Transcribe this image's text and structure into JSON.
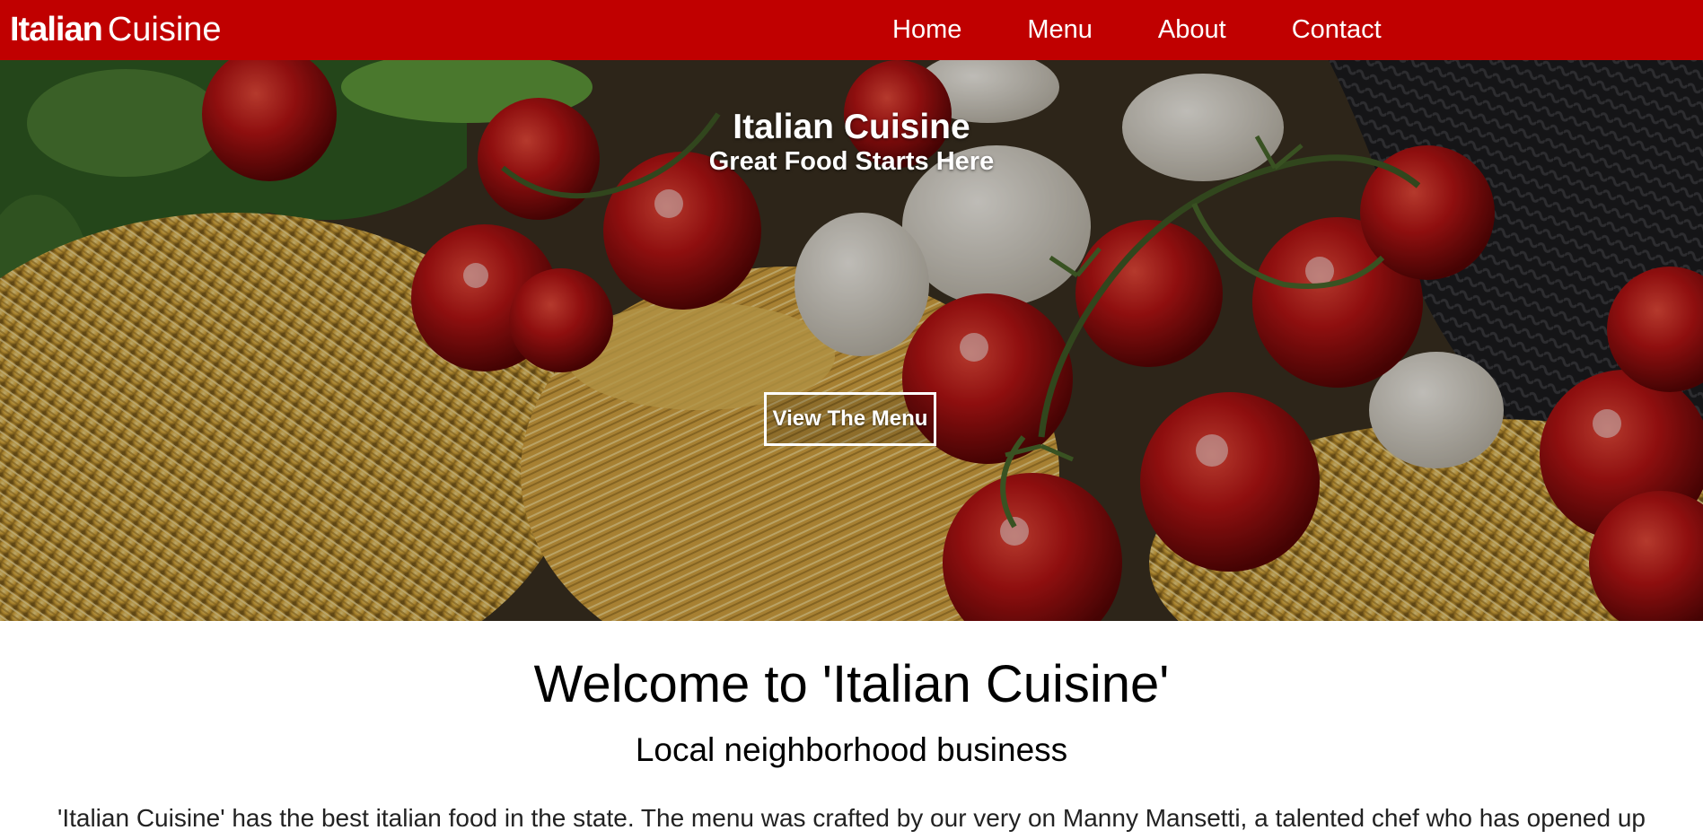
{
  "navbar": {
    "brand_bold": "Italian",
    "brand_light": "Cuisine",
    "links": [
      "Home",
      "Menu",
      "About",
      "Contact"
    ],
    "color": "#c00000"
  },
  "hero": {
    "title": "Italian Cuisine",
    "subtitle": "Great Food Starts Here",
    "button_label": "View The Menu",
    "image": "photo of fresh pasta nests, cherry tomatoes on the vine, eggs and black squid-ink pasta"
  },
  "content": {
    "welcome": "Welcome to 'Italian Cuisine'",
    "tagline": "Local neighborhood business",
    "paragraph": "'Italian Cuisine' has the best italian food in the state. The menu was crafted by our very on Manny Mansetti, a talented chef who has opened up"
  }
}
